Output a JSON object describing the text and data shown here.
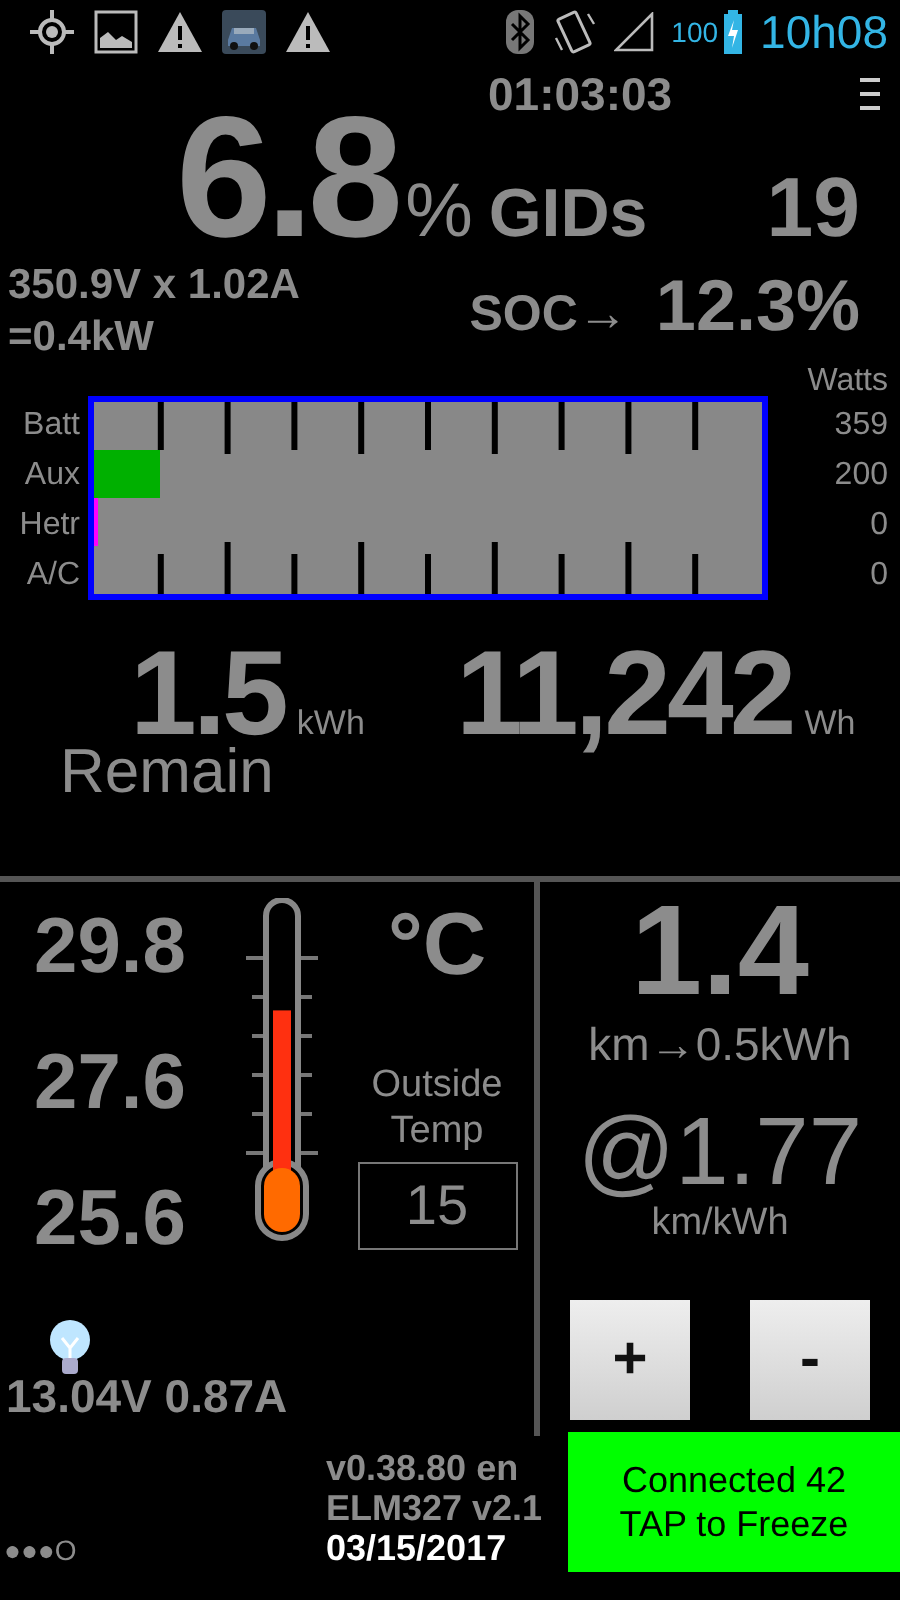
{
  "status_bar": {
    "battery_percent": "100",
    "time": "10h08"
  },
  "trip_timer": "01:03:03",
  "gids": {
    "percent": "6.8",
    "percent_sign": "%",
    "label": "GIDs",
    "value": "19"
  },
  "pack_power": {
    "line_1": "350.9V x 1.02A",
    "line_2": "=0.4kW"
  },
  "soc": {
    "label": "SOC→",
    "value": "12.3%"
  },
  "power_graph": {
    "unit_label": "Watts",
    "rows": [
      {
        "label": "Batt",
        "reading": "359"
      },
      {
        "label": "Aux",
        "reading": "200",
        "level": 0.1,
        "color": "#00b000"
      },
      {
        "label": "Hetr",
        "reading": "0",
        "level": 0.006,
        "color": "#ff00ff"
      },
      {
        "label": "A/C",
        "reading": "0"
      }
    ]
  },
  "energy": {
    "remaining": "1.5",
    "remaining_unit": "kWh",
    "remain_label": "Remain",
    "total": "11,242",
    "total_unit": "Wh"
  },
  "temperatures": {
    "readings": [
      "29.8",
      "27.6",
      "25.6"
    ],
    "thermometer": {
      "level": 0.65
    },
    "unit": "°C",
    "outside_label": "Outside Temp",
    "outside_value": "15"
  },
  "aux_battery": "13.04V 0.87A",
  "economy": {
    "distance": "1.4",
    "per_energy": "km→0.5kWh",
    "rate": "@1.77",
    "rate_unit": "km/kWh",
    "buttons": [
      "+",
      "-"
    ]
  },
  "footer": {
    "page_dots": "●●●O",
    "version": "v0.38.80 en",
    "adapter": "ELM327 v2.1",
    "date": "03/15/2017",
    "connection": [
      "Connected 42",
      "TAP to Freeze"
    ]
  }
}
